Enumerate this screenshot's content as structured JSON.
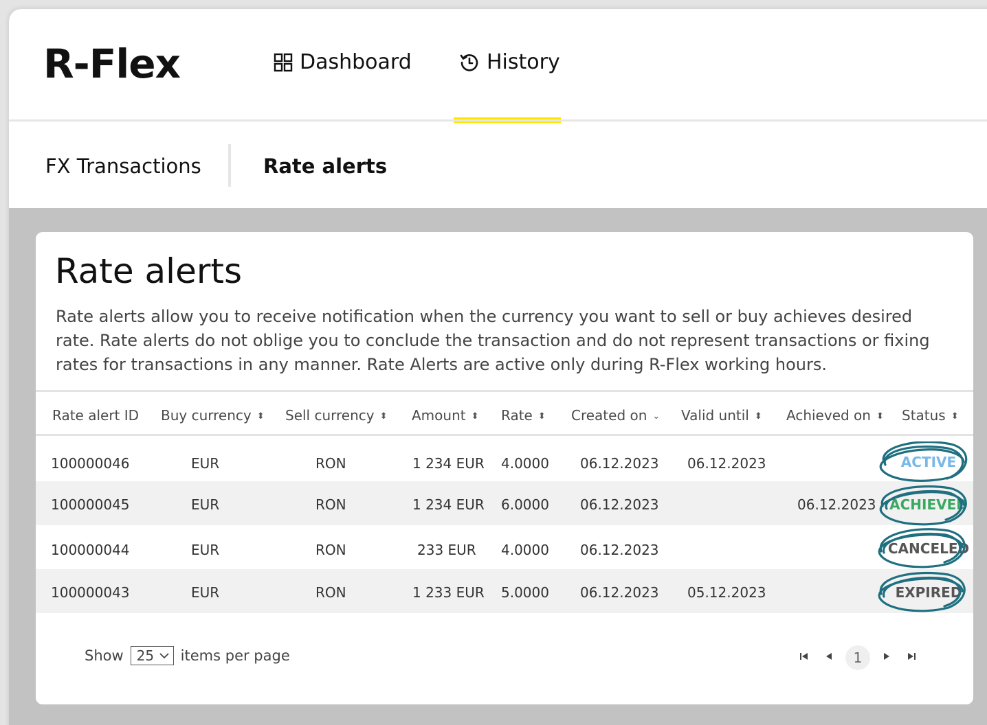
{
  "app": {
    "title": "R-Flex"
  },
  "nav": {
    "dashboard_label": "Dashboard",
    "history_label": "History",
    "active": "History",
    "accent_color": "#ffe600"
  },
  "subtabs": {
    "fx_label": "FX Transactions",
    "rate_alerts_label": "Rate alerts",
    "active": "Rate alerts"
  },
  "card": {
    "title": "Rate alerts",
    "description": "Rate alerts allow you to receive notification when the currency you want to sell or buy achieves desired rate. Rate alerts do not oblige you to conclude the transaction and do not represent transactions or fixing rates for transactions in any manner. Rate Alerts are active only during R-Flex working hours."
  },
  "table": {
    "headers": {
      "id": "Rate alert ID",
      "buy": "Buy currency",
      "sell": "Sell currency",
      "amount": "Amount",
      "rate": "Rate",
      "created": "Created on",
      "valid": "Valid until",
      "achieved": "Achieved on",
      "status": "Status"
    },
    "sort_icons": {
      "both": "⬍",
      "down": "⌄"
    },
    "rows": [
      {
        "id": "100000046",
        "buy": "EUR",
        "sell": "RON",
        "amount": "1 234 EUR",
        "rate": "4.0000",
        "created": "06.12.2023",
        "valid": "06.12.2023",
        "achieved": "",
        "status": "ACTIVE"
      },
      {
        "id": "100000045",
        "buy": "EUR",
        "sell": "RON",
        "amount": "1 234 EUR",
        "rate": "6.0000",
        "created": "06.12.2023",
        "valid": "",
        "achieved": "06.12.2023",
        "status": "ACHIEVED"
      },
      {
        "id": "100000044",
        "buy": "EUR",
        "sell": "RON",
        "amount": "233 EUR",
        "rate": "4.0000",
        "created": "06.12.2023",
        "valid": "",
        "achieved": "",
        "status": "CANCELED"
      },
      {
        "id": "100000043",
        "buy": "EUR",
        "sell": "RON",
        "amount": "1 233 EUR",
        "rate": "5.0000",
        "created": "06.12.2023",
        "valid": "05.12.2023",
        "achieved": "",
        "status": "EXPIRED"
      }
    ],
    "status_colors": {
      "ACTIVE": "#7ab8e8",
      "ACHIEVED": "#3aa860",
      "CANCELED": "#555555",
      "EXPIRED": "#555555"
    },
    "annotation_color": "#1f6f80"
  },
  "footer": {
    "show_label": "Show",
    "per_page_value": "25",
    "items_label": "items per page",
    "current_page": "1"
  }
}
